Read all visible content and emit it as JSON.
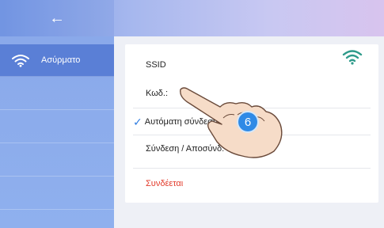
{
  "header": {
    "back_glyph": "←"
  },
  "sidebar": {
    "items": [
      {
        "label": "Ασύρματο",
        "icon": "wifi-icon"
      }
    ]
  },
  "wifi_panel": {
    "ssid_label": "SSID",
    "code_label": "Κωδ.:",
    "auto_connect_label": "Αυτόματη σύνδεση",
    "auto_connect_checked": true,
    "connect_label": "Σύνδεση / Αποσύνδ:",
    "status_text": "Συνδέεται"
  },
  "overlay": {
    "step_number": "6"
  },
  "colors": {
    "accent": "#2f7de1",
    "status_red": "#e23a2a",
    "sidebar_active": "#5a7fd6",
    "wifi_green": "#2e9a8a"
  }
}
